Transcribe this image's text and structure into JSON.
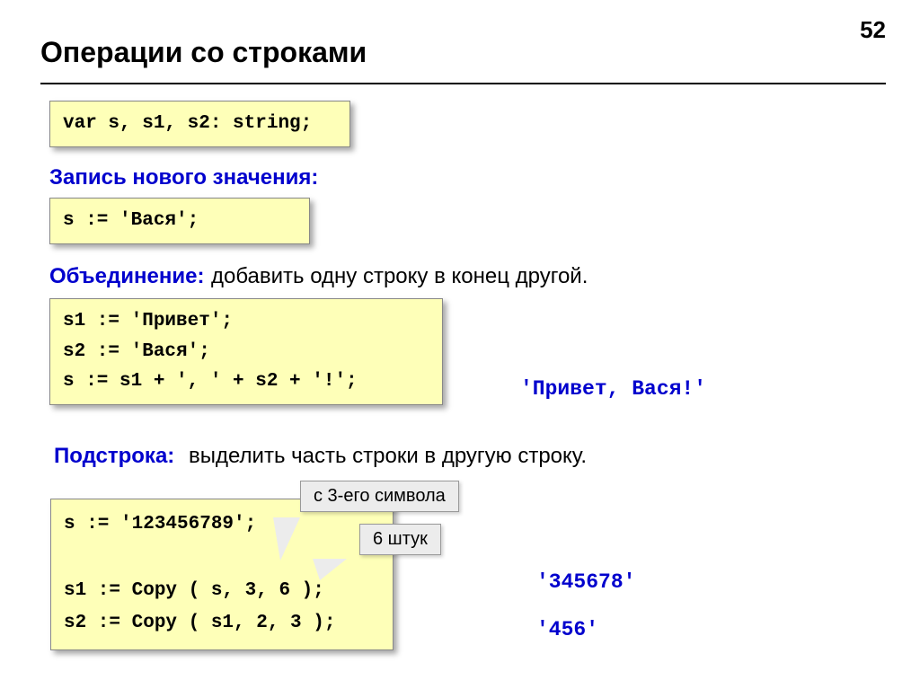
{
  "page_number": "52",
  "title": "Операции со строками",
  "code1": "var s, s1, s2: string;",
  "heading1": "Запись нового значения:",
  "code2": "s := 'Вася';",
  "heading2_blue": "Объединение:",
  "heading2_rest": "добавить одну строку в конец другой.",
  "code3": "s1 := 'Привет';\ns2 := 'Вася';\ns := s1 + ', ' + s2 + '!';",
  "output1": "'Привет, Вася!'",
  "heading3_blue": "Подстрока:",
  "heading3_rest": "выделить часть строки в другую строку.",
  "code4": "s := '123456789';\n\ns1 := Copy ( s, 3, 6 );\ns2 := Copy ( s1, 2, 3 );",
  "callout1": "с 3-его символа",
  "callout2": "6 штук",
  "output2": "'345678'",
  "output3": "'456'"
}
